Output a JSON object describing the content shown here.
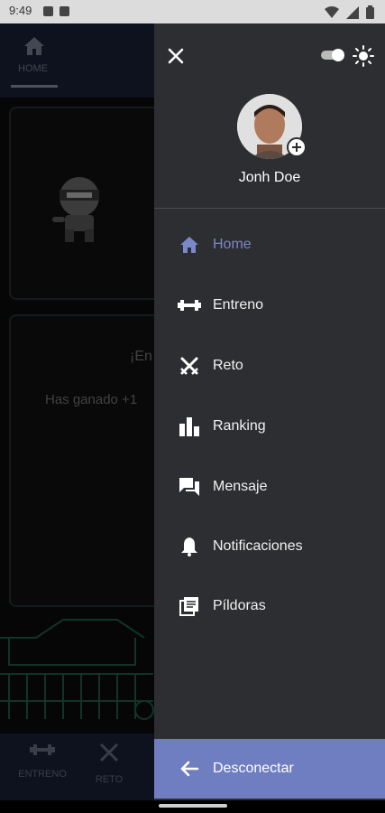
{
  "status_bar": {
    "time": "9:49"
  },
  "background_app": {
    "top_tab_label": "HOME",
    "card_title": "¡En",
    "card_text": "Has ganado +1",
    "bottom_nav": [
      {
        "label": "ENTRENO",
        "icon": "dumbbell-icon"
      },
      {
        "label": "RETO",
        "icon": "swords-icon"
      }
    ]
  },
  "drawer": {
    "user_name": "Jonh Doe",
    "menu": [
      {
        "label": "Home",
        "icon": "home-icon",
        "active": true
      },
      {
        "label": "Entreno",
        "icon": "dumbbell-icon",
        "active": false
      },
      {
        "label": "Reto",
        "icon": "swords-icon",
        "active": false
      },
      {
        "label": "Ranking",
        "icon": "ranking-icon",
        "active": false
      },
      {
        "label": "Mensaje",
        "icon": "chat-icon",
        "active": false
      },
      {
        "label": "Notificaciones",
        "icon": "bell-icon",
        "active": false
      },
      {
        "label": "Píldoras",
        "icon": "pills-icon",
        "active": false
      }
    ],
    "logout_label": "Desconectar"
  },
  "colors": {
    "drawer_bg": "#2d2e31",
    "accent": "#7b88c9",
    "logout_bg": "#6f7ec0",
    "nav_bg": "#1b2038"
  }
}
